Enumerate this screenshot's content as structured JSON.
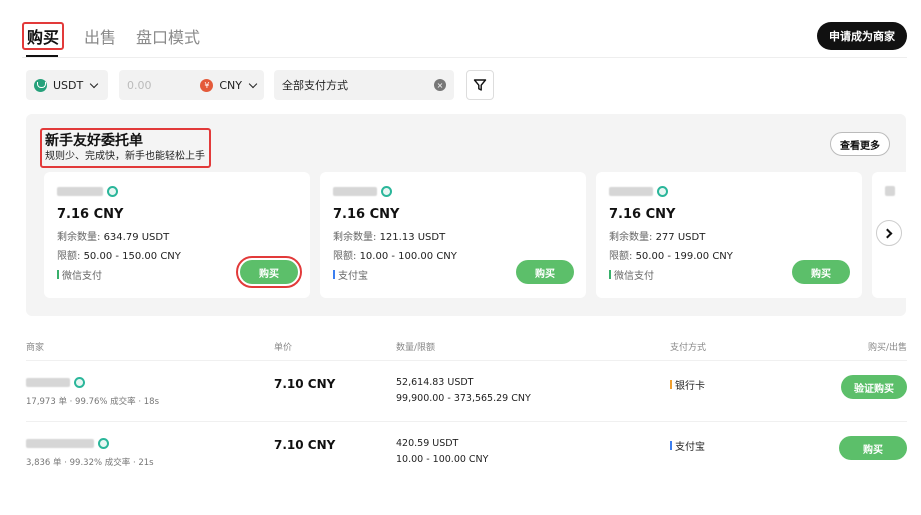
{
  "tabs": [
    {
      "label": "购买"
    },
    {
      "label": "出售"
    },
    {
      "label": "盘口模式"
    }
  ],
  "merchant_button": "申请成为商家",
  "filters": {
    "coin": "USDT",
    "amount_placeholder": "0.00",
    "currency": "CNY",
    "currency_symbol": "¥",
    "payment": "全部支付方式",
    "clear_symbol": "×"
  },
  "beginner": {
    "title": "新手友好委托单",
    "subtitle": "规则少、完成快，新手也能轻松上手",
    "more_label": "查看更多",
    "cards": [
      {
        "price": "7.16 CNY",
        "remain_label": "剩余数量:",
        "remain": "634.79 USDT",
        "limit_label": "限额:",
        "limit": "50.00 - 150.00 CNY",
        "payment": "微信支付",
        "buy_label": "购买"
      },
      {
        "price": "7.16 CNY",
        "remain_label": "剩余数量:",
        "remain": "121.13 USDT",
        "limit_label": "限额:",
        "limit": "10.00 - 100.00 CNY",
        "payment": "支付宝",
        "buy_label": "购买"
      },
      {
        "price": "7.16 CNY",
        "remain_label": "剩余数量:",
        "remain": "277 USDT",
        "limit_label": "限额:",
        "limit": "50.00 - 199.00 CNY",
        "payment": "微信支付",
        "buy_label": "购买"
      }
    ]
  },
  "table": {
    "headers": {
      "merchant": "商家",
      "price": "单价",
      "qty": "数量/限额",
      "method": "支付方式",
      "action": "购买/出售"
    },
    "rows": [
      {
        "stats": "17,973 单 · 99.76% 成交率 · 18s",
        "price": "7.10 CNY",
        "qty": "52,614.83 USDT",
        "limit": "99,900.00 - 373,565.29 CNY",
        "method": "银行卡",
        "action": "验证购买"
      },
      {
        "stats": "3,836 单 · 99.32% 成交率 · 21s",
        "price": "7.10 CNY",
        "qty": "420.59 USDT",
        "limit": "10.00 - 100.00 CNY",
        "method": "支付宝",
        "action": "购买"
      }
    ]
  }
}
